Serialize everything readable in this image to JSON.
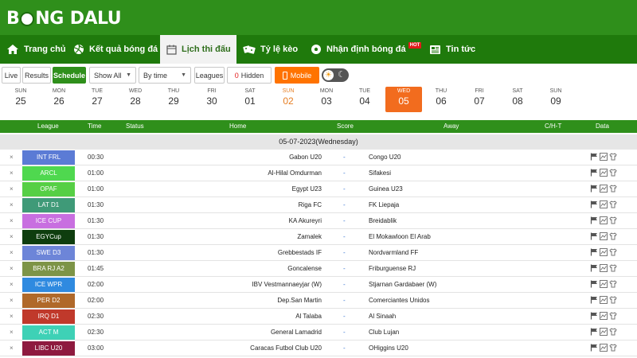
{
  "logo": {
    "part1": "B",
    "part2": "NG",
    "part3": "DALU"
  },
  "nav": [
    {
      "label": "Trang chủ",
      "icon": "home-icon",
      "active": false
    },
    {
      "label": "Kết quả bóng đá",
      "icon": "volleyball-icon",
      "active": false
    },
    {
      "label": "Lịch thi đấu",
      "icon": "calendar-icon",
      "active": true
    },
    {
      "label": "Tỷ lệ kèo",
      "icon": "dice-icon",
      "active": false
    },
    {
      "label": "Nhận định bóng đá",
      "icon": "soccer-ball-icon",
      "active": false,
      "badge": "HOT"
    },
    {
      "label": "Tin tức",
      "icon": "news-icon",
      "active": false
    }
  ],
  "toolbar": {
    "live": "Live",
    "results": "Results",
    "schedule": "Schedule",
    "show_all": "Show All",
    "by_time": "By time",
    "leagues": "Leagues",
    "hidden_count": "0",
    "hidden_label": "Hidden",
    "mobile": "Mobile"
  },
  "dates": [
    {
      "dow": "SUN",
      "day": "25"
    },
    {
      "dow": "MON",
      "day": "26"
    },
    {
      "dow": "TUE",
      "day": "27"
    },
    {
      "dow": "WED",
      "day": "28"
    },
    {
      "dow": "THU",
      "day": "29"
    },
    {
      "dow": "FRI",
      "day": "30"
    },
    {
      "dow": "SAT",
      "day": "01"
    },
    {
      "dow": "SUN",
      "day": "02"
    },
    {
      "dow": "MON",
      "day": "03"
    },
    {
      "dow": "TUE",
      "day": "04"
    },
    {
      "dow": "WED",
      "day": "05"
    },
    {
      "dow": "THU",
      "day": "06"
    },
    {
      "dow": "FRI",
      "day": "07"
    },
    {
      "dow": "SAT",
      "day": "08"
    },
    {
      "dow": "SUN",
      "day": "09"
    }
  ],
  "table": {
    "headers": {
      "league": "League",
      "time": "Time",
      "status": "Status",
      "home": "Home",
      "score": "Score",
      "away": "Away",
      "chth": "C/H-T",
      "data": "Data"
    },
    "date_label": "05-07-2023(Wednesday)",
    "rows": [
      {
        "league": "INT FRL",
        "color": "#5b7bd5",
        "time": "00:30",
        "home": "Gabon U20",
        "score": "-",
        "away": "Congo U20"
      },
      {
        "league": "ARCL",
        "color": "#4fd84f",
        "time": "01:00",
        "home": "Al-Hilal Omdurman",
        "score": "-",
        "away": "Sifakesi"
      },
      {
        "league": "OPAF",
        "color": "#56cf45",
        "time": "01:00",
        "home": "Egypt U23",
        "score": "-",
        "away": "Guinea U23"
      },
      {
        "league": "LAT D1",
        "color": "#3f9a78",
        "time": "01:30",
        "home": "Riga FC",
        "score": "-",
        "away": "FK Liepaja"
      },
      {
        "league": "ICE CUP",
        "color": "#c86fe0",
        "time": "01:30",
        "home": "KA Akureyri",
        "score": "-",
        "away": "Breidablik"
      },
      {
        "league": "EGYCup",
        "color": "#0e3d0e",
        "time": "01:30",
        "home": "Zamalek",
        "score": "-",
        "away": "El Mokawloon El Arab"
      },
      {
        "league": "SWE D3",
        "color": "#6d85d8",
        "time": "01:30",
        "home": "Grebbestads IF",
        "score": "-",
        "away": "Nordvarmland FF"
      },
      {
        "league": "BRA RJ A2",
        "color": "#7d9447",
        "time": "01:45",
        "home": "Goncalense",
        "score": "-",
        "away": "Friburguense RJ"
      },
      {
        "league": "ICE WPR",
        "color": "#2f8ae0",
        "time": "02:00",
        "home": "IBV Vestmannaeyjar (W)",
        "score": "-",
        "away": "Stjarnan Gardabaer (W)"
      },
      {
        "league": "PER D2",
        "color": "#b0692a",
        "time": "02:00",
        "home": "Dep.San Martin",
        "score": "-",
        "away": "Comerciantes Unidos"
      },
      {
        "league": "IRQ D1",
        "color": "#c0392b",
        "time": "02:30",
        "home": "Al Talaba",
        "score": "-",
        "away": "Al Sinaah"
      },
      {
        "league": "ACT M",
        "color": "#3ed1b6",
        "time": "02:30",
        "home": "General Lamadrid",
        "score": "-",
        "away": "Club Lujan"
      },
      {
        "league": "LIBC U20",
        "color": "#8e1a3f",
        "time": "03:00",
        "home": "Caracas Futbol Club U20",
        "score": "-",
        "away": "OHiggins U20"
      }
    ]
  }
}
